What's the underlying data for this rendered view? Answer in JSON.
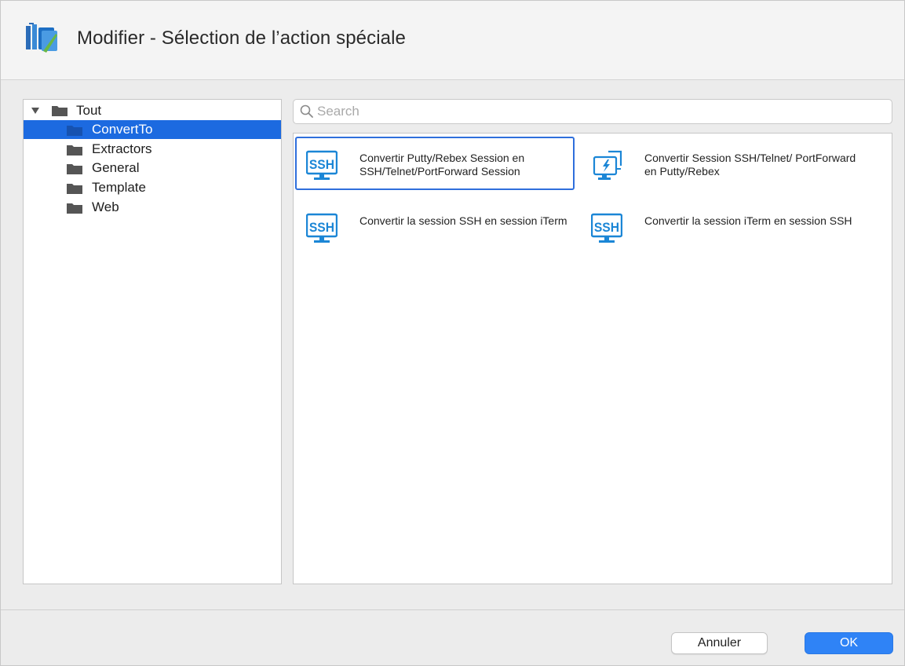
{
  "window": {
    "title": "Modifier - Sélection de l’action spéciale",
    "app_icon": "devolutions-rdm-icon"
  },
  "tree": {
    "root": {
      "label": "Tout",
      "icon": "folder-icon",
      "expanded": true
    },
    "items": [
      {
        "label": "ConvertTo",
        "icon": "folder-icon",
        "selected": true
      },
      {
        "label": "Extractors",
        "icon": "folder-icon",
        "selected": false
      },
      {
        "label": "General",
        "icon": "folder-icon",
        "selected": false
      },
      {
        "label": "Template",
        "icon": "folder-icon",
        "selected": false
      },
      {
        "label": "Web",
        "icon": "folder-icon",
        "selected": false
      }
    ]
  },
  "search": {
    "placeholder": "Search",
    "value": ""
  },
  "actions": [
    {
      "label": "Convertir Putty/Rebex Session en SSH/Telnet/PortForward Session",
      "icon": "ssh-monitor-icon",
      "selected": true
    },
    {
      "label": "Convertir Session SSH/Telnet/ PortForward en Putty/Rebex",
      "icon": "lightning-monitor-icon",
      "selected": false
    },
    {
      "label": "Convertir la session SSH en session iTerm",
      "icon": "ssh-monitor-icon",
      "selected": false
    },
    {
      "label": "Convertir la session iTerm en session SSH",
      "icon": "ssh-monitor-icon",
      "selected": false
    }
  ],
  "buttons": {
    "cancel": "Annuler",
    "ok": "OK"
  },
  "colors": {
    "accent": "#1c6ae0",
    "ok_button": "#2f83f6",
    "icon_blue": "#1b86d6"
  }
}
